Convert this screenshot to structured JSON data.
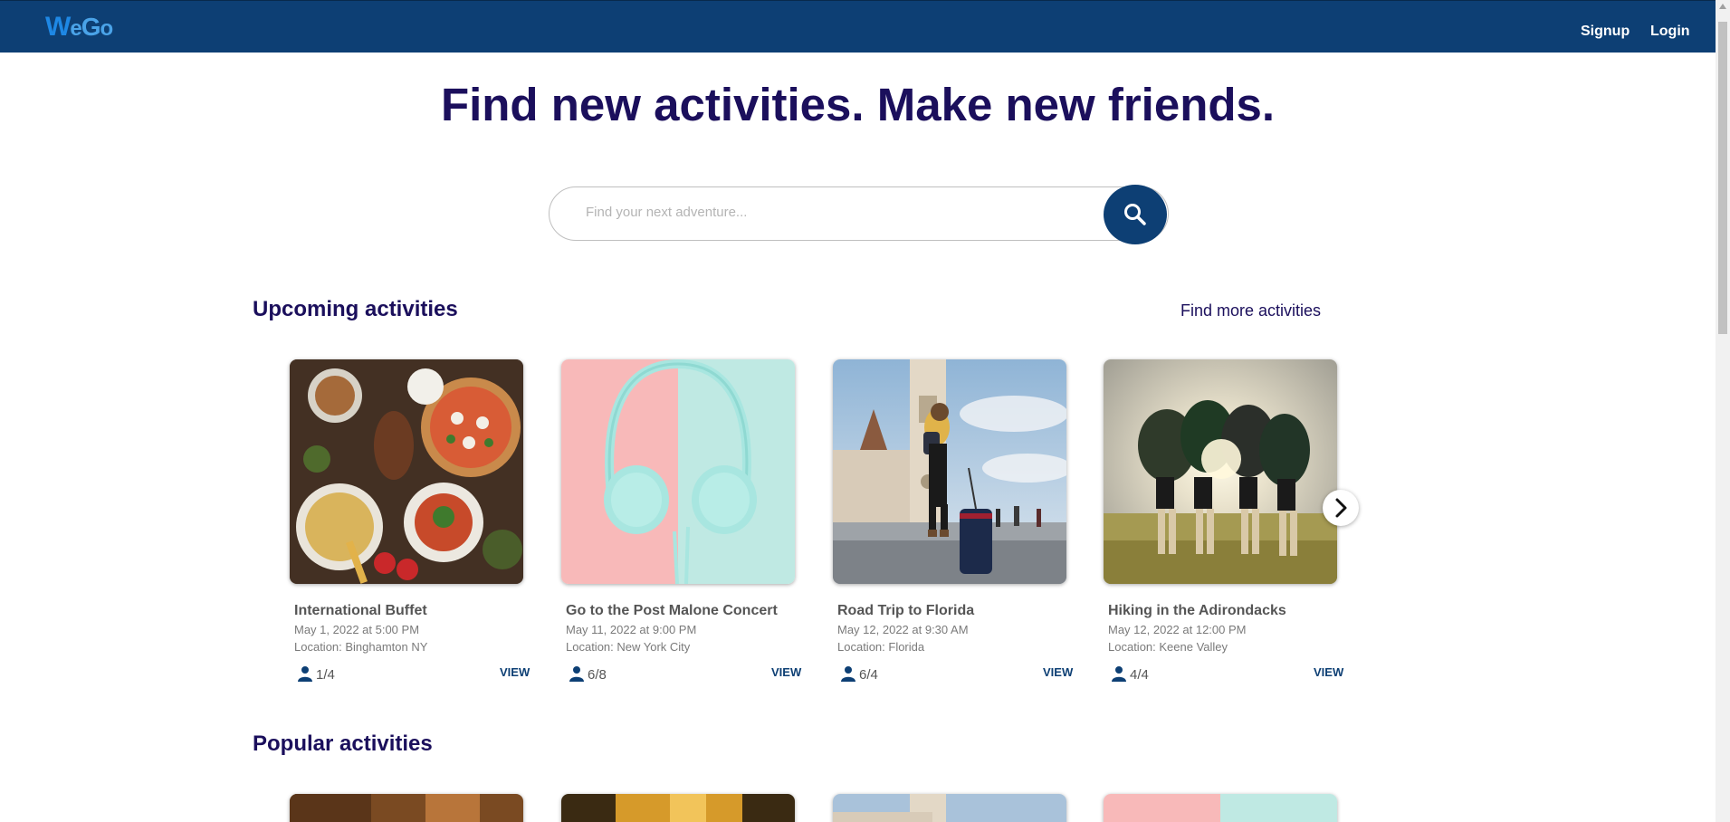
{
  "navbar": {
    "logo": "WeGo",
    "signup_label": "Signup",
    "login_label": "Login"
  },
  "hero": {
    "title": "Find new activities. Make new friends."
  },
  "search": {
    "placeholder": "Find your next adventure...",
    "icon": "search-icon"
  },
  "upcoming": {
    "title": "Upcoming activities",
    "find_more_label": "Find more activities",
    "cards": [
      {
        "title": "International Buffet",
        "date": "May 1, 2022 at 5:00 PM",
        "location": "Location: Binghamton NY",
        "attendees": "1/4",
        "view_label": "VIEW",
        "image": "food-spread-image"
      },
      {
        "title": "Go to the Post Malone Concert",
        "date": "May 11, 2022 at 9:00 PM",
        "location": "Location: New York City",
        "attendees": "6/8",
        "view_label": "VIEW",
        "image": "headphones-image"
      },
      {
        "title": "Road Trip to Florida",
        "date": "May 12, 2022 at 9:30 AM",
        "location": "Location: Florida",
        "attendees": "6/4",
        "view_label": "VIEW",
        "image": "traveler-church-image"
      },
      {
        "title": "Hiking in the Adirondacks",
        "date": "May 12, 2022 at 12:00 PM",
        "location": "Location: Keene Valley",
        "attendees": "4/4",
        "view_label": "VIEW",
        "image": "team-huddle-image"
      }
    ]
  },
  "popular": {
    "title": "Popular activities"
  },
  "colors": {
    "navbar": "#0d3f74",
    "heading": "#1b0f5c",
    "accent": "#1e88e5"
  }
}
